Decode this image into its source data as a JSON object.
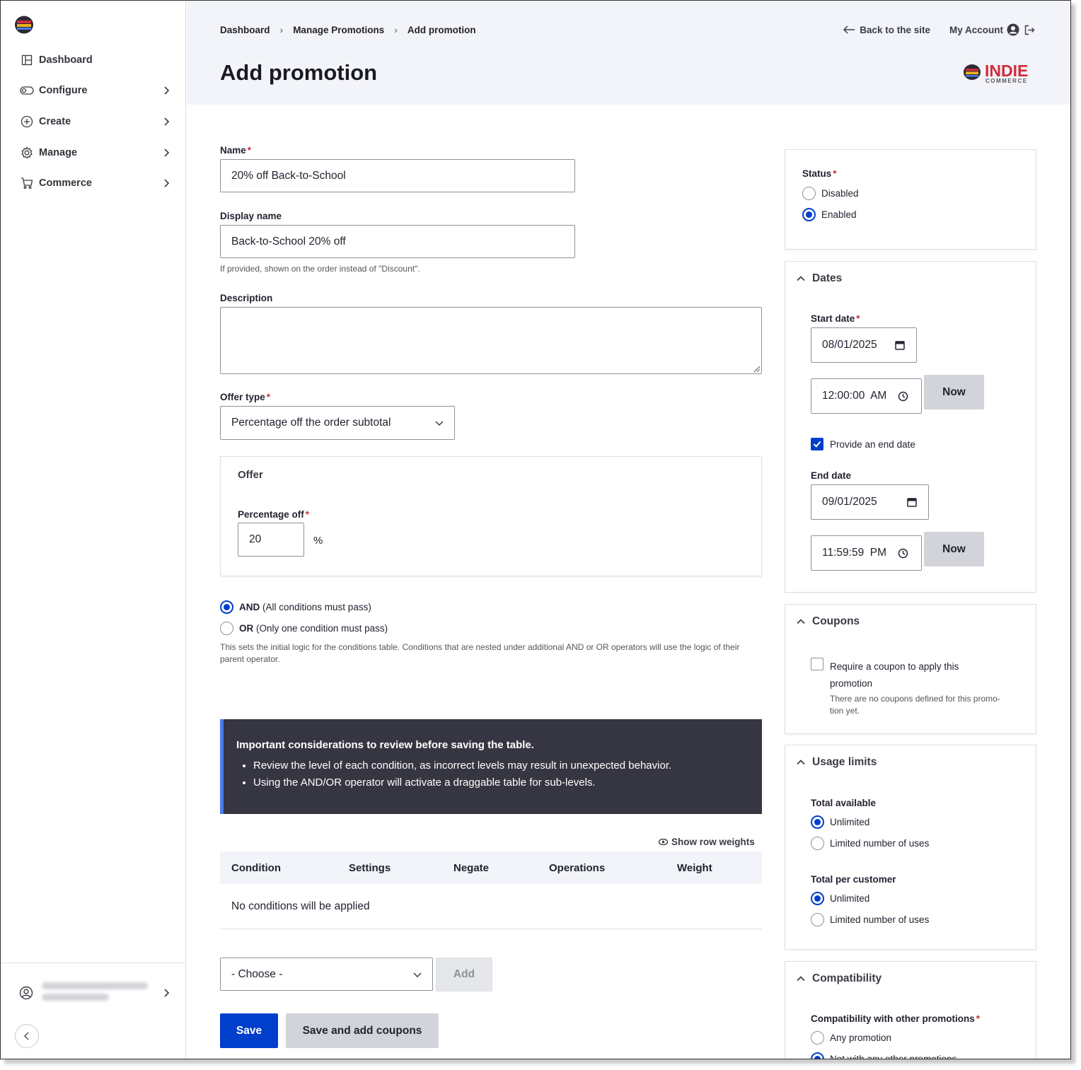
{
  "sidebar": {
    "items": [
      {
        "label": "Dashboard",
        "icon": "dashboard-icon"
      },
      {
        "label": "Configure",
        "icon": "toggle-icon"
      },
      {
        "label": "Create",
        "icon": "plus-circle-icon"
      },
      {
        "label": "Manage",
        "icon": "gear-icon"
      },
      {
        "label": "Commerce",
        "icon": "cart-icon"
      }
    ]
  },
  "header": {
    "breadcrumb": [
      "Dashboard",
      "Manage Promotions",
      "Add promotion"
    ],
    "title": "Add promotion",
    "back_link": "Back to the site",
    "account_link": "My Account",
    "brand": {
      "line1": "INDIE",
      "line2": "COMMERCE",
      "accent": "#d12c3b"
    }
  },
  "form": {
    "name": {
      "label": "Name",
      "value": "20% off Back-to-School"
    },
    "display_name": {
      "label": "Display name",
      "value": "Back-to-School 20% off",
      "help": "If provided, shown on the order instead of \"Discount\"."
    },
    "description": {
      "label": "Description",
      "value": ""
    },
    "offer_type": {
      "label": "Offer type",
      "value": "Percentage off the order subtotal"
    },
    "offer": {
      "title": "Offer",
      "percentage_label": "Percentage off",
      "percentage_value": "20",
      "unit": "%"
    },
    "logic": {
      "and_bold": "AND",
      "and_rest": "(All conditions must pass)",
      "or_bold": "OR",
      "or_rest": "(Only one condition must pass)",
      "help": "This sets the initial logic for the conditions table. Conditions that are nested under additional AND or OR operators will use the logic of their parent operator.",
      "selected": "AND"
    },
    "notice": {
      "title": "Important considerations to review before saving the table.",
      "items": [
        "Review the level of each condition, as incorrect levels may result in unexpected behavior.",
        "Using the AND/OR operator will activate a draggable table for sub-levels."
      ]
    },
    "conditions": {
      "show_weights": "Show row weights",
      "columns": [
        "Condition",
        "Settings",
        "Negate",
        "Operations",
        "Weight"
      ],
      "empty": "No conditions will be applied",
      "choose": "- Choose -",
      "add": "Add"
    },
    "save": "Save",
    "save_coupons": "Save and add coupons"
  },
  "right": {
    "status": {
      "label": "Status",
      "options": [
        "Disabled",
        "Enabled"
      ],
      "selected": "Enabled"
    },
    "dates": {
      "title": "Dates",
      "start_label": "Start date",
      "start_date": "08/01/2025",
      "start_time": "12:00:00  AM",
      "now": "Now",
      "end_checkbox": "Provide an end date",
      "end_checked": true,
      "end_label": "End date",
      "end_date": "09/01/2025",
      "end_time": "11:59:59  PM"
    },
    "coupons": {
      "title": "Coupons",
      "checkbox_line1": "Require a coupon to apply this",
      "checkbox_line2": "promotion",
      "help_line1": "There are no coupons defined for this promo-",
      "help_line2": "tion yet."
    },
    "usage": {
      "title": "Usage limits",
      "total_label": "Total available",
      "customer_label": "Total per customer",
      "opt_unlimited": "Unlimited",
      "opt_limited": "Limited number of uses"
    },
    "compat": {
      "title": "Compatibility",
      "label": "Compatibility with other promotions",
      "opt_any": "Any promotion",
      "opt_not": "Not with any other promotions"
    }
  }
}
